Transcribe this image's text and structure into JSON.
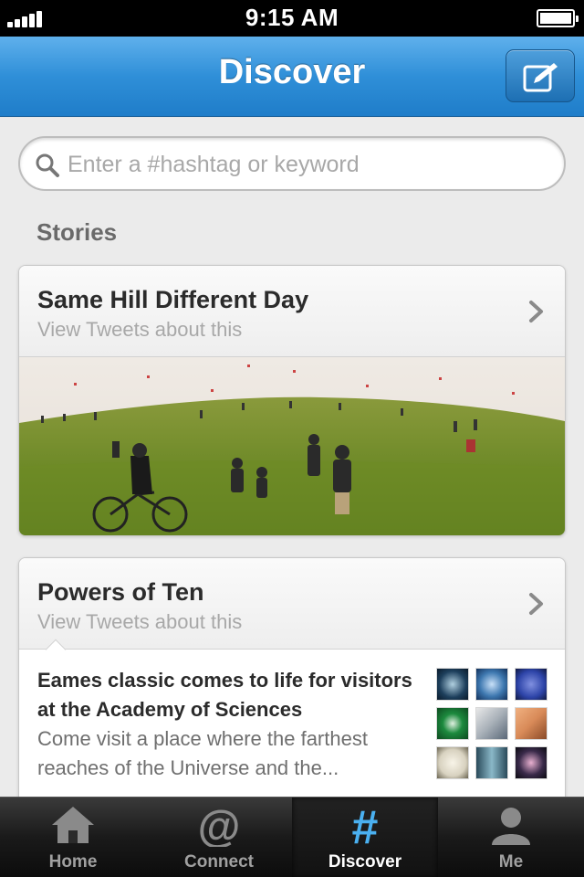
{
  "status_bar": {
    "time": "9:15 AM"
  },
  "nav": {
    "title": "Discover",
    "compose_icon": "compose-icon"
  },
  "search": {
    "placeholder": "Enter a #hashtag or keyword",
    "value": ""
  },
  "stories": {
    "section_title": "Stories",
    "items": [
      {
        "title": "Same Hill Different Day",
        "subtitle": "View Tweets about this",
        "image": "hill-kites-photo"
      },
      {
        "title": "Powers of Ten",
        "subtitle": "View Tweets about this",
        "article_title": "Eames classic comes to life for visitors at the Academy of Sciences",
        "article_desc": "Come visit a place where the farthest reaches of the Universe and the...",
        "thumbnail_colors": [
          "#1d3f5c",
          "#3e78b0",
          "#2d44a8",
          "#1c8a3e",
          "#a8b0b8",
          "#d88a58",
          "#d8d2c0",
          "#5a8aa0",
          "#3a2a4a"
        ]
      }
    ]
  },
  "tabbar": {
    "tabs": [
      {
        "label": "Home",
        "icon": "home-icon"
      },
      {
        "label": "Connect",
        "icon": "at-icon"
      },
      {
        "label": "Discover",
        "icon": "hashtag-icon"
      },
      {
        "label": "Me",
        "icon": "person-icon"
      }
    ],
    "active": "Discover"
  },
  "colors": {
    "nav_blue": "#2f8fd8",
    "active_tab_icon": "#4ab0f0"
  }
}
